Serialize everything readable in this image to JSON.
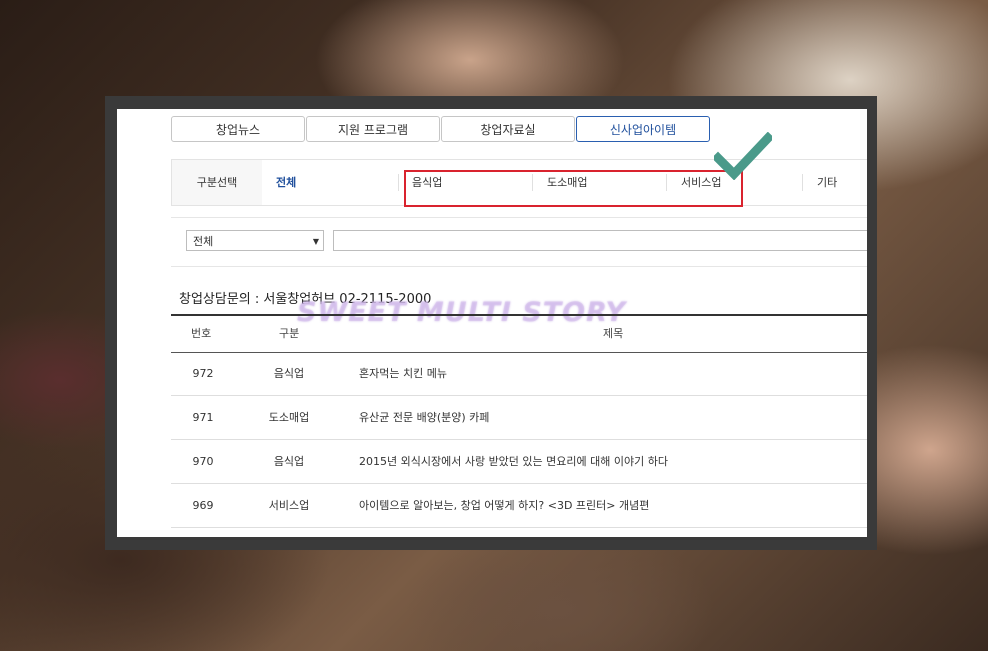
{
  "tabs": [
    "창업뉴스",
    "지원 프로그램",
    "창업자료실",
    "신사업아이템"
  ],
  "category": {
    "label": "구분선택",
    "items": [
      "전체",
      "음식업",
      "도소매업",
      "서비스업",
      "기타"
    ]
  },
  "filter": {
    "selected": "전체",
    "arrow": "▼"
  },
  "contact": "창업상담문의 : 서울창업허브 02-2115-2000",
  "watermark": "SWEET MULTI STORY",
  "table": {
    "headers": [
      "번호",
      "구분",
      "제목"
    ],
    "rows": [
      {
        "num": "972",
        "type": "음식업",
        "title": "혼자먹는 치킨 메뉴"
      },
      {
        "num": "971",
        "type": "도소매업",
        "title": "유산균 전문 배양(분양) 카페"
      },
      {
        "num": "970",
        "type": "음식업",
        "title": "2015년 외식시장에서 사랑 받았던 있는 면요리에 대해 이야기 하다"
      },
      {
        "num": "969",
        "type": "서비스업",
        "title": "아이템으로 알아보는, 창업 어떻게 하지? <3D 프린터> 개념편"
      }
    ]
  },
  "colors": {
    "accent": "#1f4f9c",
    "highlight": "#d9232e",
    "check": "#4a9a8a"
  }
}
